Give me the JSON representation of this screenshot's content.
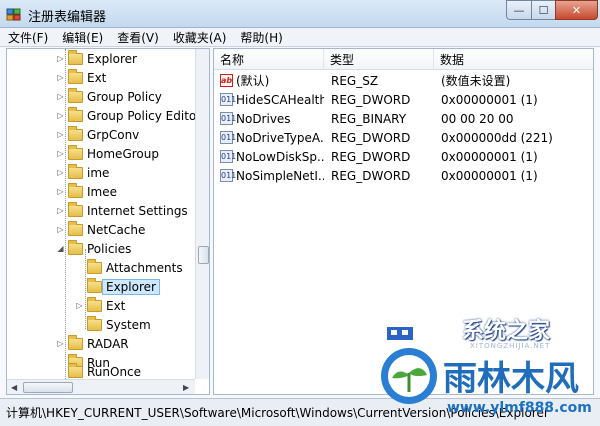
{
  "window": {
    "title": "注册表编辑器",
    "controls": {
      "minimize": "—",
      "maximize": "☐",
      "close": "✕"
    }
  },
  "menu": [
    "文件(F)",
    "编辑(E)",
    "查看(V)",
    "收藏夹(A)",
    "帮助(H)"
  ],
  "tree": {
    "items": [
      {
        "label": "Explorer",
        "expander": "▷"
      },
      {
        "label": "Ext",
        "expander": "▷"
      },
      {
        "label": "Group Policy",
        "expander": "▷"
      },
      {
        "label": "Group Policy Editor",
        "expander": "▷"
      },
      {
        "label": "GrpConv",
        "expander": "▷"
      },
      {
        "label": "HomeGroup",
        "expander": "▷"
      },
      {
        "label": "ime",
        "expander": "▷"
      },
      {
        "label": "Imee",
        "expander": "▷"
      },
      {
        "label": "Internet Settings",
        "expander": "▷"
      },
      {
        "label": "NetCache",
        "expander": "▷"
      },
      {
        "label": "Policies",
        "expander": "◢"
      },
      {
        "label": "Attachments",
        "expander": ""
      },
      {
        "label": "Explorer",
        "expander": "",
        "selected": true
      },
      {
        "label": "Ext",
        "expander": "▷"
      },
      {
        "label": "System",
        "expander": ""
      },
      {
        "label": "RADAR",
        "expander": "▷"
      },
      {
        "label": "Run",
        "expander": ""
      },
      {
        "label": "RunOnce",
        "expander": ""
      }
    ]
  },
  "list": {
    "columns": [
      "名称",
      "类型",
      "数据"
    ],
    "rows": [
      {
        "icon": "ab",
        "kind": "string-value-icon",
        "name": "(默认)",
        "type": "REG_SZ",
        "data": "(数值未设置)"
      },
      {
        "icon": "011",
        "kind": "binary-value-icon",
        "name": "HideSCAHealth",
        "type": "REG_DWORD",
        "data": "0x00000001 (1)"
      },
      {
        "icon": "011",
        "kind": "binary-value-icon",
        "name": "NoDrives",
        "type": "REG_BINARY",
        "data": "00 00 20 00"
      },
      {
        "icon": "011",
        "kind": "binary-value-icon",
        "name": "NoDriveTypeA...",
        "type": "REG_DWORD",
        "data": "0x000000dd (221)"
      },
      {
        "icon": "011",
        "kind": "binary-value-icon",
        "name": "NoLowDiskSp...",
        "type": "REG_DWORD",
        "data": "0x00000001 (1)"
      },
      {
        "icon": "011",
        "kind": "binary-value-icon",
        "name": "NoSimpleNetI...",
        "type": "REG_DWORD",
        "data": "0x00000001 (1)"
      }
    ]
  },
  "status": "计算机\\HKEY_CURRENT_USER\\Software\\Microsoft\\Windows\\CurrentVersion\\Policies\\Explorer",
  "watermark": {
    "top_text": "系统之家",
    "top_sub": "XITONGZHIJIA.NET",
    "brand": "雨林木风",
    "url": "www.ylmf888.com"
  },
  "colors": {
    "accent": "#1f6dbb",
    "selection": "#cde8ff"
  }
}
